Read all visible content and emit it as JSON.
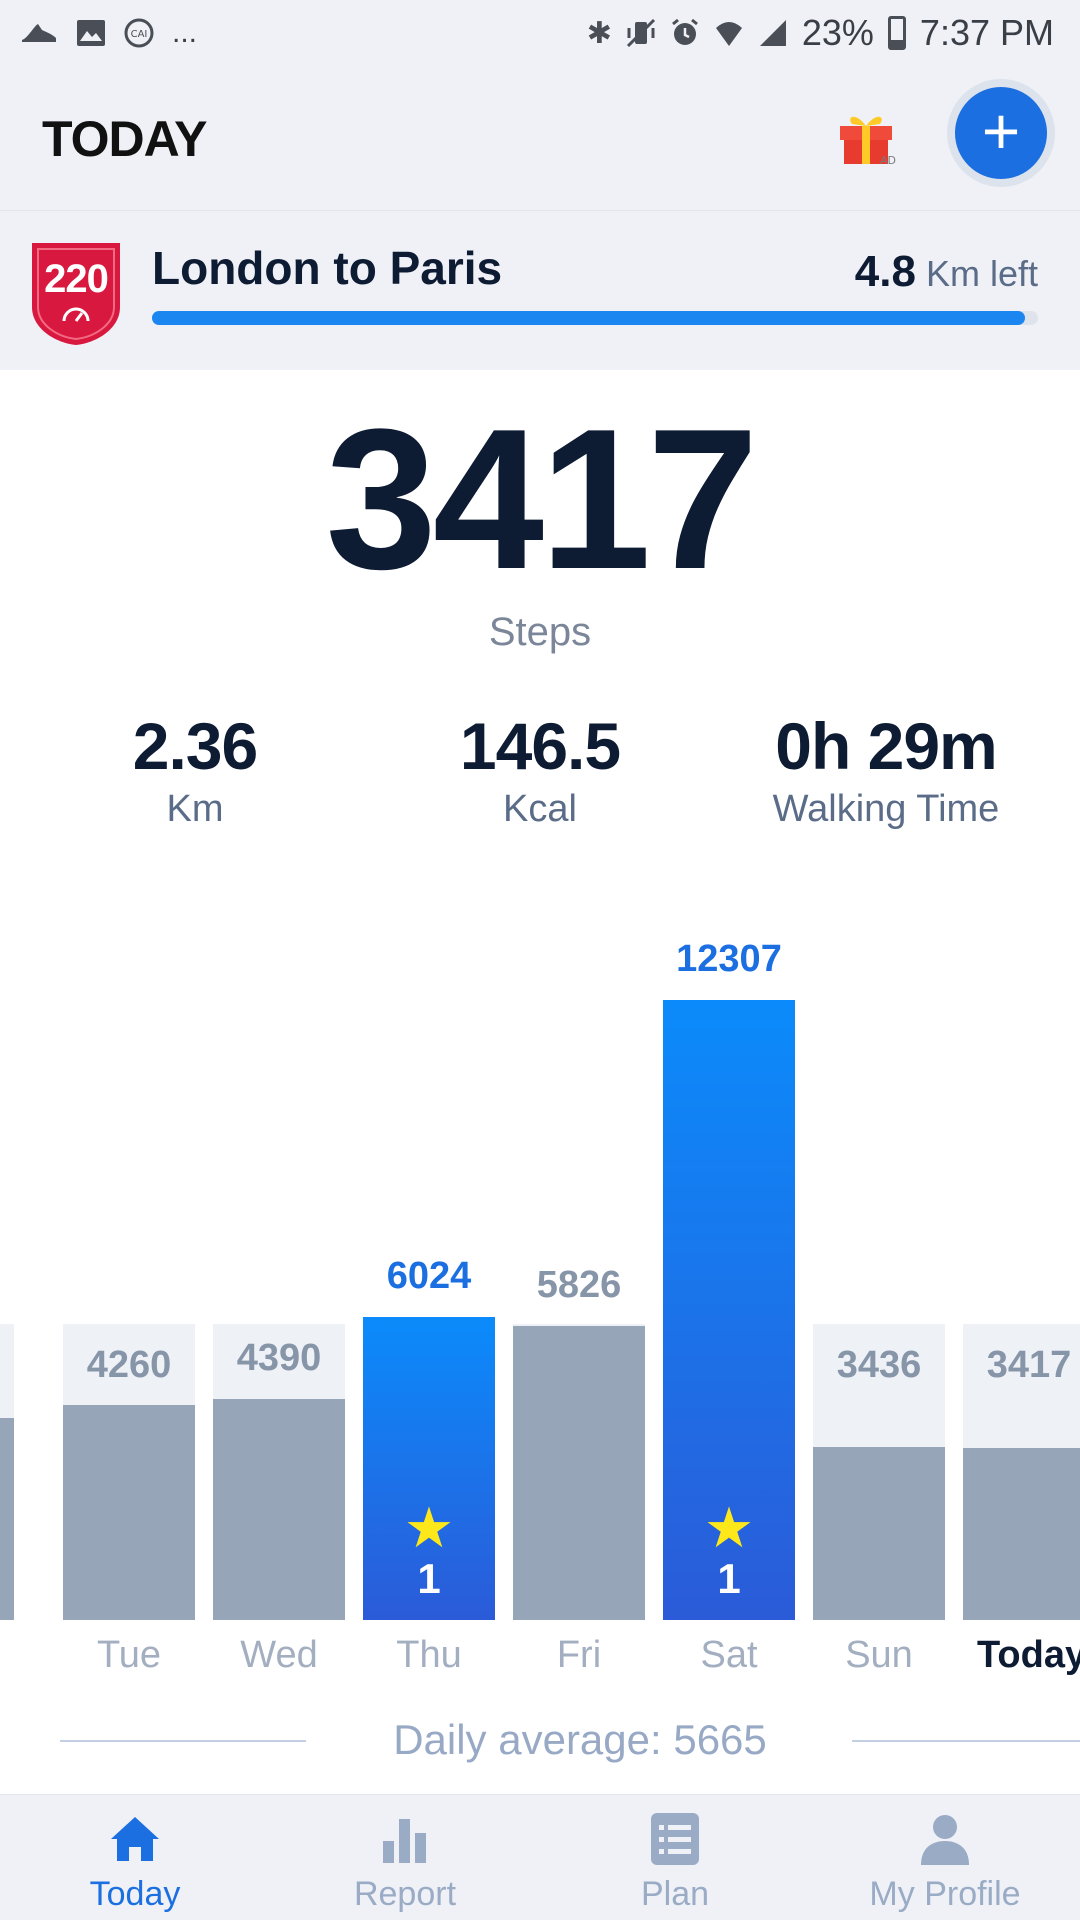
{
  "status_bar": {
    "left_icons": [
      "shoe-icon",
      "image-icon",
      "cai-icon"
    ],
    "overflow": "...",
    "right_icons": [
      "bluetooth-icon",
      "vibrate-icon",
      "alarm-icon",
      "wifi-icon",
      "signal-icon"
    ],
    "battery": "23%",
    "time": "7:37 PM"
  },
  "header": {
    "title": "TODAY",
    "gift_badge": "AD",
    "add_icon": "plus-icon"
  },
  "challenge": {
    "badge_number": "220",
    "title": "London to Paris",
    "remaining_value": "4.8",
    "remaining_unit": "Km left",
    "progress": 0.985
  },
  "summary": {
    "steps": "3417",
    "steps_label": "Steps",
    "stats": [
      {
        "value": "2.36",
        "label": "Km"
      },
      {
        "value": "146.5",
        "label": "Kcal"
      },
      {
        "value": "0h 29m",
        "label": "Walking Time"
      }
    ]
  },
  "chart_data": {
    "type": "bar",
    "categories": [
      "Tue",
      "Wed",
      "Thu",
      "Fri",
      "Sat",
      "Sun",
      "Today"
    ],
    "values": [
      4260,
      4390,
      6024,
      5826,
      12307,
      3436,
      3417
    ],
    "goal_met": [
      false,
      false,
      true,
      false,
      true,
      false,
      false
    ],
    "goal_stars": [
      "",
      "",
      "1",
      "",
      "1",
      "",
      ""
    ],
    "daily_average_label": "Daily average: 5665",
    "colors": {
      "goal_met": "#1b86f0",
      "normal": "#96a5b8",
      "background": "#eef1f6"
    }
  },
  "nav": {
    "items": [
      {
        "label": "Today",
        "icon": "home-icon",
        "active": true
      },
      {
        "label": "Report",
        "icon": "bar-chart-icon",
        "active": false
      },
      {
        "label": "Plan",
        "icon": "list-icon",
        "active": false
      },
      {
        "label": "My Profile",
        "icon": "person-icon",
        "active": false
      }
    ]
  }
}
